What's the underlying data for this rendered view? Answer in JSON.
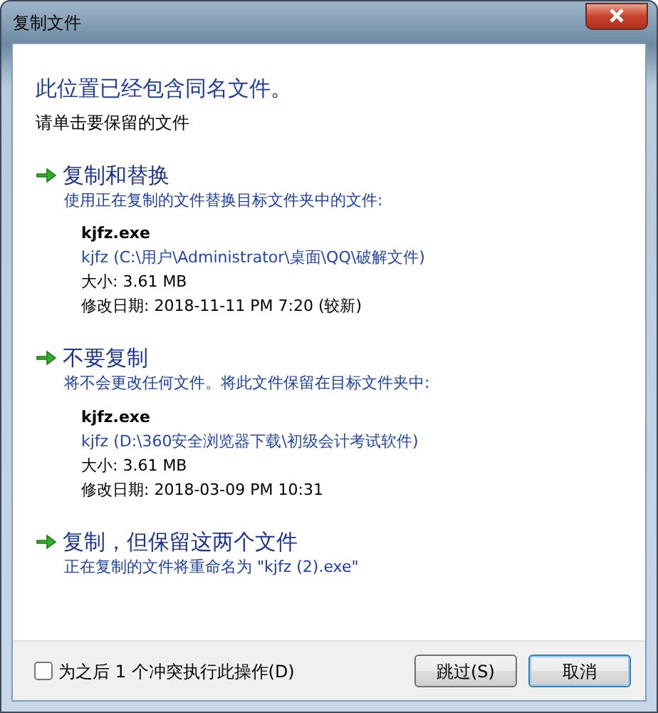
{
  "window": {
    "title": "复制文件"
  },
  "heading": "此位置已经包含同名文件。",
  "subheading": "请单击要保留的文件",
  "options": [
    {
      "title": "复制和替换",
      "description": "使用正在复制的文件替换目标文件夹中的文件:",
      "file": {
        "name": "kjfz.exe",
        "path": "kjfz (C:\\用户\\Administrator\\桌面\\QQ\\破解文件)",
        "size": "大小: 3.61 MB",
        "modified": "修改日期: 2018-11-11 PM 7:20 (较新)"
      }
    },
    {
      "title": "不要复制",
      "description": "将不会更改任何文件。将此文件保留在目标文件夹中:",
      "file": {
        "name": "kjfz.exe",
        "path": "kjfz (D:\\360安全浏览器下载\\初级会计考试软件)",
        "size": "大小: 3.61 MB",
        "modified": "修改日期: 2018-03-09 PM 10:31"
      }
    },
    {
      "title": "复制，但保留这两个文件",
      "description": "正在复制的文件将重命名为 \"kjfz (2).exe\""
    }
  ],
  "footer": {
    "checkbox": {
      "label": "为之后 1 个冲突执行此操作(D)",
      "checked": false
    },
    "buttons": [
      {
        "label": "跳过(S)",
        "focused": false
      },
      {
        "label": "取消",
        "focused": true
      }
    ]
  }
}
